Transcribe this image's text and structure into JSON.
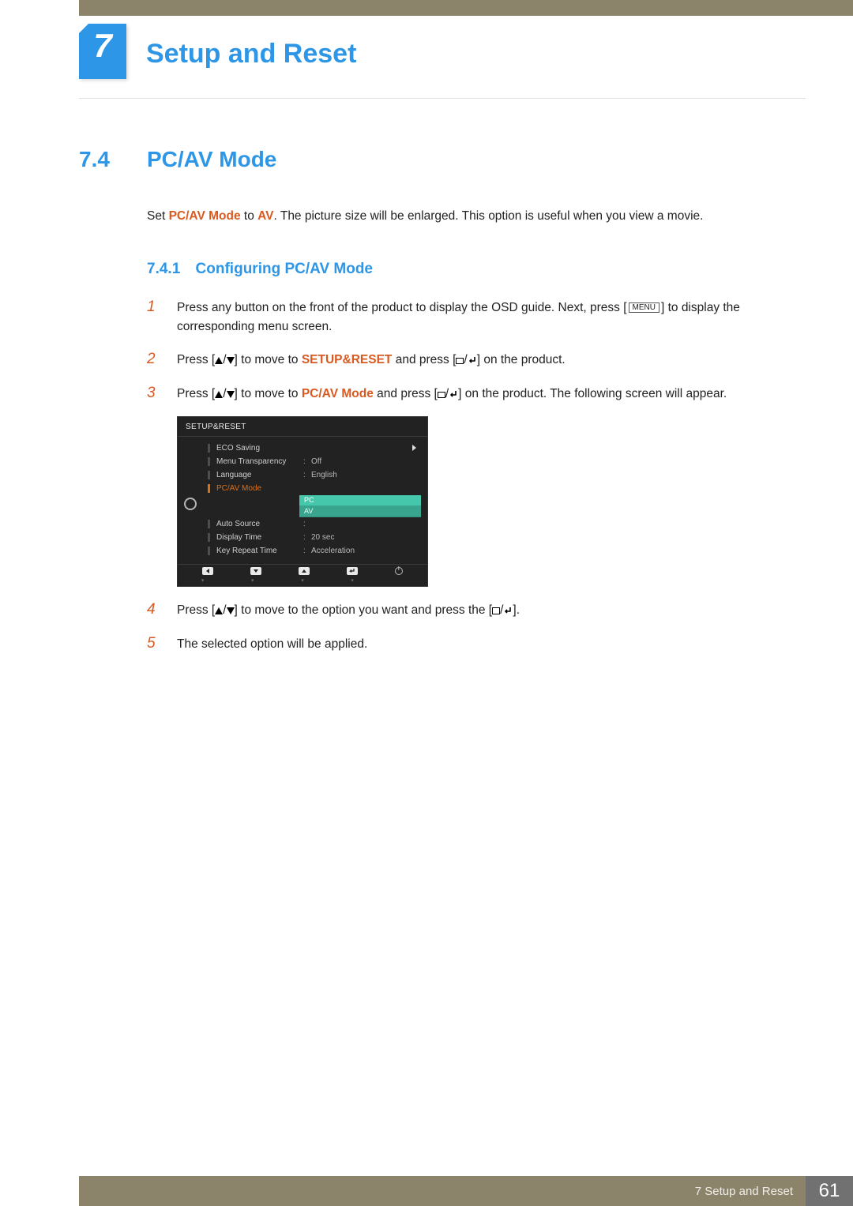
{
  "chapter": {
    "number": "7",
    "title": "Setup and Reset"
  },
  "section": {
    "number": "7.4",
    "title": "PC/AV Mode"
  },
  "intro": {
    "pre": "Set ",
    "bold1": "PC/AV Mode",
    "mid": " to ",
    "bold2": "AV",
    "post": ". The picture size will be enlarged. This option is useful when you view a movie."
  },
  "subsection": {
    "number": "7.4.1",
    "title": "Configuring PC/AV Mode"
  },
  "menu_key_label": "MENU",
  "steps": {
    "s1": {
      "num": "1",
      "pre": "Press any button on the front of the product to display the OSD guide. Next, press [",
      "post": "] to display the corresponding menu screen."
    },
    "s2": {
      "num": "2",
      "pre": "Press [",
      "mid1": "] to move to ",
      "bold": "SETUP&RESET",
      "mid2": " and press [",
      "post": "] on the product."
    },
    "s3": {
      "num": "3",
      "pre": "Press [",
      "mid1": "] to move to ",
      "bold": "PC/AV Mode",
      "mid2": " and press [",
      "post": "] on the product. The following screen will appear."
    },
    "s4": {
      "num": "4",
      "pre": "Press [",
      "mid": "] to move to the option you want and press the [",
      "post": "]."
    },
    "s5": {
      "num": "5",
      "text": "The selected option will be applied."
    }
  },
  "osd": {
    "title": "SETUP&RESET",
    "rows": [
      {
        "label": "ECO Saving",
        "value": "",
        "arrow": true
      },
      {
        "label": "Menu Transparency",
        "value": "Off"
      },
      {
        "label": "Language",
        "value": "English"
      },
      {
        "label": "PC/AV Mode",
        "value": "",
        "selected": true
      },
      {
        "label": "Auto Source",
        "value": ""
      },
      {
        "label": "Display Time",
        "value": "20 sec"
      },
      {
        "label": "Key Repeat Time",
        "value": "Acceleration"
      }
    ],
    "options": [
      "PC",
      "AV"
    ]
  },
  "footer": {
    "text": "7 Setup and Reset",
    "page": "61"
  }
}
